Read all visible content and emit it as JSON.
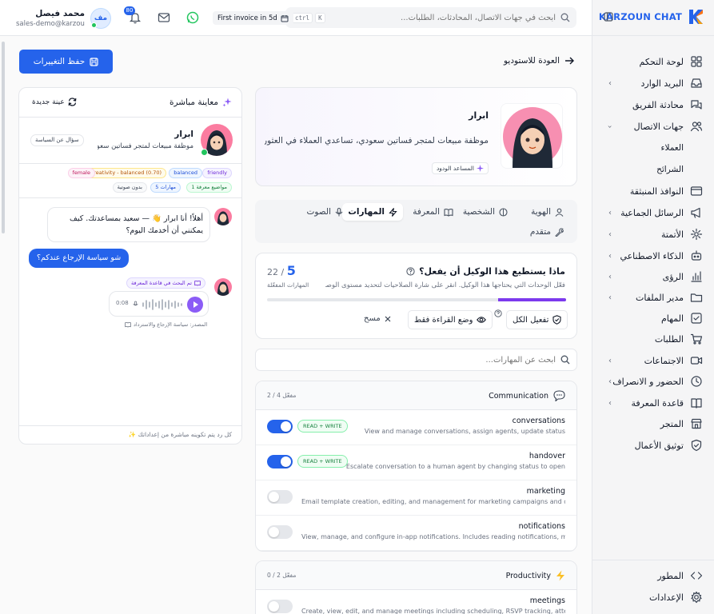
{
  "brand": {
    "name": "KARZOUN CHAT"
  },
  "sidebar": {
    "items": [
      {
        "label": "لوحة التحكم",
        "icon": "dashboard-icon",
        "chevron": false
      },
      {
        "label": "البريد الوارد",
        "icon": "inbox-icon",
        "chevron": true
      },
      {
        "label": "محادثة الفريق",
        "icon": "team-chat-icon",
        "chevron": false
      },
      {
        "label": "جهات الاتصال",
        "icon": "contacts-icon",
        "chevron": "open"
      },
      {
        "label": "النوافذ المنبثقة",
        "icon": "popup-window-icon",
        "chevron": false
      },
      {
        "label": "الرسائل الجماعية",
        "icon": "megaphone-icon",
        "chevron": true
      },
      {
        "label": "الأتمتة",
        "icon": "automation-icon",
        "chevron": true
      },
      {
        "label": "الذكاء الاصطناعي",
        "icon": "robot-icon",
        "chevron": true
      },
      {
        "label": "الرؤى",
        "icon": "chart-icon",
        "chevron": true
      },
      {
        "label": "مدير الملفات",
        "icon": "folder-icon",
        "chevron": true
      },
      {
        "label": "المهام",
        "icon": "task-icon",
        "chevron": false
      },
      {
        "label": "الطلبات",
        "icon": "cart-icon",
        "chevron": false
      },
      {
        "label": "الاجتماعات",
        "icon": "video-icon",
        "chevron": true
      },
      {
        "label": "الحضور و الانصراف",
        "icon": "clock-icon",
        "chevron": true
      },
      {
        "label": "قاعدة المعرفة",
        "icon": "book-icon",
        "chevron": true
      },
      {
        "label": "المتجر",
        "icon": "store-icon",
        "chevron": false
      },
      {
        "label": "توثيق الأعمال",
        "icon": "verify-icon",
        "chevron": false
      }
    ],
    "subitems": [
      "العملاء",
      "الشرائح"
    ],
    "bottom": [
      {
        "label": "المطور",
        "icon": "code-icon"
      },
      {
        "label": "الإعدادات",
        "icon": "settings-icon"
      }
    ]
  },
  "topbar": {
    "search_placeholder": "ابحث في جهات الاتصال، المحادثات، الطلبات...",
    "kbd": [
      "ctrl",
      "K"
    ],
    "invoice": "First invoice in 5d",
    "notifications_count": "80",
    "user_initials": "مف",
    "user_name": "محمد فيصل",
    "user_email": "sales-demo@karzoun..."
  },
  "main": {
    "back_label": "العودة للاستوديو",
    "save_label": "حفظ التغييرات",
    "profile": {
      "name": "ابرار",
      "description": "موظفة مبيعات لمتجر فساتين سعودي، تساعدي العملاء في العثور ع...",
      "tag": "المساعد الودود"
    },
    "tabs": [
      {
        "label": "الهوية",
        "icon": "user-icon"
      },
      {
        "label": "الشخصية",
        "icon": "brain-icon"
      },
      {
        "label": "المعرفة",
        "icon": "book-open-icon"
      },
      {
        "label": "المهارات",
        "icon": "zap-icon",
        "active": true
      },
      {
        "label": "الصوت",
        "icon": "mic-icon"
      },
      {
        "label": "متقدم",
        "icon": "wrench-icon"
      }
    ],
    "capabilities": {
      "title": "ماذا يستطيع هذا الوكيل أن يفعل؟",
      "description": "فعّل الوحدات التي يحتاجها هذا الوكيل. انقر على شارة الصلاحيات لتحديد مستوى الوصول.",
      "enabled": "5",
      "total": "22",
      "count_label": "المهارات المفعّلة",
      "progress": 0.227,
      "enable_all": "تفعيل الكل",
      "read_only": "وضع القراءة فقط",
      "clear": "مسح"
    },
    "skill_search_placeholder": "ابحث عن المهارات...",
    "groups": [
      {
        "title": "Communication",
        "count": "2 / 4 مفعّل",
        "icon": "chat-bubble-icon",
        "perms": [
          {
            "name": "conversations",
            "desc": "View and manage conversations, assign agents, update status",
            "on": true,
            "badge": "READ + WRITE"
          },
          {
            "name": "handover",
            "desc": "Escalate conversation to a human agent by changing status to open",
            "on": true,
            "badge": "READ + WRITE"
          },
          {
            "name": "marketing",
            "desc": "Email template creation, editing, and management for marketing campaigns and outbound...",
            "on": false,
            "badge": ""
          },
          {
            "name": "notifications",
            "desc": "View, manage, and configure in-app notifications. Includes reading notifications, marking as...",
            "on": false,
            "badge": ""
          }
        ]
      },
      {
        "title": "Productivity",
        "count": "0 / 2 مفعّل",
        "icon": "lightning-icon",
        "perms": [
          {
            "name": "meetings",
            "desc": "Create, view, edit, and manage meetings including scheduling, RSVP tracking, attendance...",
            "on": false,
            "badge": ""
          }
        ]
      }
    ]
  },
  "preview": {
    "title": "معاينة مباشرة",
    "new_sample": "عينة جديدة",
    "agent_name": "ابرار",
    "agent_desc": "موظفة مبيعات لمتجر فساتين سعود...",
    "policy_question": "سؤال عن السياسة",
    "chips": [
      "friendly",
      "balanced",
      "creativity - balanced (0.70)",
      "female",
      "1 مواضيع معرفة",
      "5 مهارات",
      "بدون صوتية"
    ],
    "bot_message": "أهلاً! أنا ابرار 👋 — سعيد بمساعدتك. كيف يمكنني أن أخدمك اليوم؟",
    "user_message": "شو سياسة الإرجاع عندكم؟",
    "kb_tag": "تم البحث في قاعدة المعرفة",
    "audio_time": "0:08",
    "source": "المصدر: سياسة الإرجاع والاسترداد",
    "footer": "كل رد يتم تكوينه مباشرة من إعداداتك ✨"
  },
  "colors": {
    "accent": "#2563eb",
    "progress": "#7c3aed",
    "online": "#22c55e"
  }
}
